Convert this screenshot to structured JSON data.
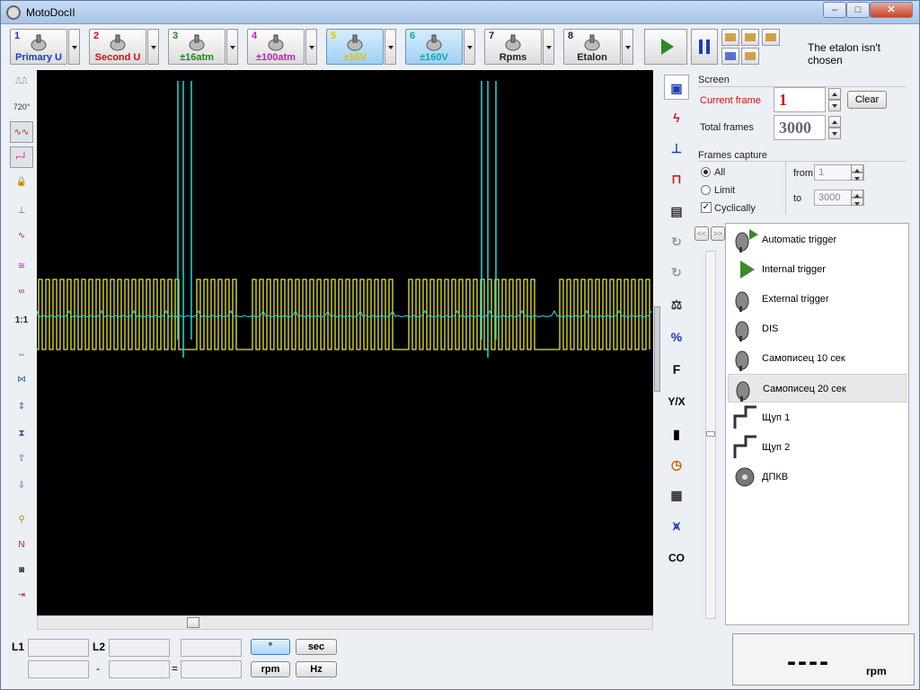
{
  "window": {
    "title": "MotoDocII",
    "controls": [
      "–",
      "□",
      "✕"
    ]
  },
  "toolbar": {
    "channels": [
      {
        "num": "1",
        "label": "Primary U",
        "color": "#1a3bbf",
        "icon": "coil-icon",
        "active": false
      },
      {
        "num": "2",
        "label": "Second U",
        "color": "#d01010",
        "icon": "spark-plug-icon",
        "active": false
      },
      {
        "num": "3",
        "label": "±16atm",
        "color": "#1a8a1a",
        "icon": "pressure-sensor-icon",
        "active": false
      },
      {
        "num": "4",
        "label": "±100atm",
        "color": "#c020c0",
        "icon": "pressure-sensor-icon",
        "active": false
      },
      {
        "num": "5",
        "label": "±16V",
        "color": "#d8c800",
        "icon": "probe-icon",
        "active": true
      },
      {
        "num": "6",
        "label": "±160V",
        "color": "#10a8a8",
        "icon": "probe-icon",
        "active": true
      },
      {
        "num": "7",
        "label": "Rpms",
        "color": "#222222",
        "icon": "rpm-arrow-icon",
        "active": false
      },
      {
        "num": "8",
        "label": "Etalon",
        "color": "#222222",
        "icon": "etalon-probe-icon",
        "active": false
      }
    ],
    "etalon_status": "The etalon isn't chosen"
  },
  "screen": {
    "group_title": "Screen",
    "current_frame_label": "Current frame",
    "current_frame_value": "1",
    "clear_label": "Clear",
    "total_frames_label": "Total frames",
    "total_frames_value": "3000"
  },
  "capture": {
    "group_title": "Frames capture",
    "all_label": "All",
    "limit_label": "Limit",
    "cyclically_label": "Cyclically",
    "from_label": "from",
    "from_value": "1",
    "to_label": "to",
    "to_value": "3000",
    "selected": "All",
    "cyclically_checked": true
  },
  "triggers": {
    "nav_prev": "<<",
    "nav_next": ">>",
    "items": [
      {
        "label": "Automatic trigger",
        "icon": "auto-trigger-icon",
        "selected": false
      },
      {
        "label": "Internal trigger",
        "icon": "internal-trigger-icon",
        "selected": false
      },
      {
        "label": "External trigger",
        "icon": "external-trigger-icon",
        "selected": false
      },
      {
        "label": "DIS",
        "icon": "dis-trigger-icon",
        "selected": false
      },
      {
        "label": "Самописец 10 сек",
        "icon": "recorder-icon",
        "selected": false
      },
      {
        "label": "Самописец 20 сек",
        "icon": "recorder-icon",
        "selected": true
      },
      {
        "label": "Щуп 1",
        "icon": "probe1-icon",
        "selected": false
      },
      {
        "label": "Щуп 2",
        "icon": "probe2-icon",
        "selected": false
      },
      {
        "label": "ДПКВ",
        "icon": "crank-sensor-icon",
        "selected": false
      }
    ]
  },
  "right_tools": {
    "f_label": "F",
    "yx_label": "Y/X",
    "co_label": "CO"
  },
  "left_tools": {
    "ratio_label": "1:1",
    "angle_label": "720°"
  },
  "bottom": {
    "l1_label": "L1",
    "l2_label": "L2",
    "minus_sign": "-",
    "equals_sign": "=",
    "deg_label": "°",
    "sec_label": "sec",
    "rpm_label": "rpm",
    "hz_label": "Hz",
    "rpm_display_value": "----",
    "rpm_display_unit": "rpm"
  },
  "scope": {
    "background": "#000000",
    "trace_colors": {
      "ch5": "#e8e830",
      "ch6": "#20d8e0"
    }
  }
}
